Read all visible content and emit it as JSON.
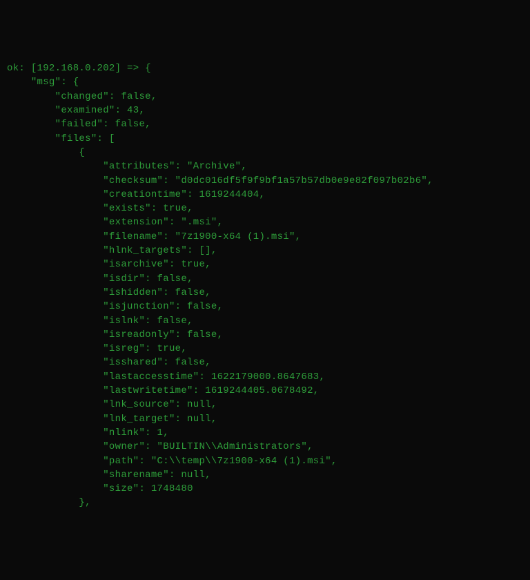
{
  "header": {
    "status": "ok",
    "host": "[192.168.0.202]",
    "arrow": "=>",
    "open": "{"
  },
  "msg_key": "\"msg\"",
  "msg_open": ": {",
  "fields": {
    "changed": {
      "key": "\"changed\"",
      "val": ": false,"
    },
    "examined": {
      "key": "\"examined\"",
      "val": ": 43,"
    },
    "failed": {
      "key": "\"failed\"",
      "val": ": false,"
    },
    "files_key": "\"files\"",
    "files_open": ": [",
    "file_open": "{"
  },
  "file": {
    "attributes": {
      "key": "\"attributes\"",
      "val": ": \"Archive\","
    },
    "checksum": {
      "key": "\"checksum\"",
      "val": ": \"d0dc016df5f9f9bf1a57b57db0e9e82f097b02b6\","
    },
    "creationtime": {
      "key": "\"creationtime\"",
      "val": ": 1619244404,"
    },
    "exists": {
      "key": "\"exists\"",
      "val": ": true,"
    },
    "extension": {
      "key": "\"extension\"",
      "val": ": \".msi\","
    },
    "filename": {
      "key": "\"filename\"",
      "val": ": \"7z1900-x64 (1).msi\","
    },
    "hlnk_targets": {
      "key": "\"hlnk_targets\"",
      "val": ": [],"
    },
    "isarchive": {
      "key": "\"isarchive\"",
      "val": ": true,"
    },
    "isdir": {
      "key": "\"isdir\"",
      "val": ": false,"
    },
    "ishidden": {
      "key": "\"ishidden\"",
      "val": ": false,"
    },
    "isjunction": {
      "key": "\"isjunction\"",
      "val": ": false,"
    },
    "islnk": {
      "key": "\"islnk\"",
      "val": ": false,"
    },
    "isreadonly": {
      "key": "\"isreadonly\"",
      "val": ": false,"
    },
    "isreg": {
      "key": "\"isreg\"",
      "val": ": true,"
    },
    "isshared": {
      "key": "\"isshared\"",
      "val": ": false,"
    },
    "lastaccesstime": {
      "key": "\"lastaccesstime\"",
      "val": ": 1622179000.8647683,"
    },
    "lastwritetime": {
      "key": "\"lastwritetime\"",
      "val": ": 1619244405.0678492,"
    },
    "lnk_source": {
      "key": "\"lnk_source\"",
      "val": ": null,"
    },
    "lnk_target": {
      "key": "\"lnk_target\"",
      "val": ": null,"
    },
    "nlink": {
      "key": "\"nlink\"",
      "val": ": 1,"
    },
    "owner": {
      "key": "\"owner\"",
      "val": ": \"BUILTIN\\\\Administrators\","
    },
    "path": {
      "key": "\"path\"",
      "val": ": \"C:\\\\temp\\\\7z1900-x64 (1).msi\","
    },
    "sharename": {
      "key": "\"sharename\"",
      "val": ": null,"
    },
    "size": {
      "key": "\"size\"",
      "val": ": 1748480"
    }
  },
  "file_close": "},",
  "indent": {
    "i1": "    ",
    "i2": "        ",
    "i3": "            ",
    "i4": "                "
  }
}
